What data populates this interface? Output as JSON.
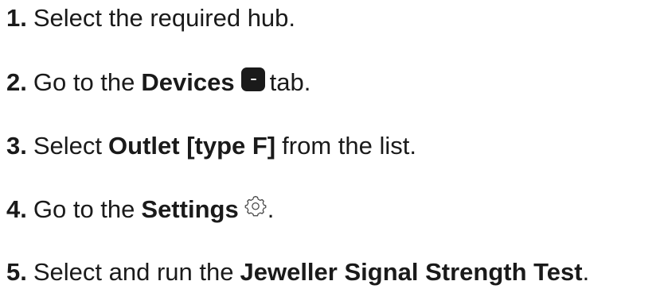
{
  "steps": [
    {
      "number": "1.",
      "parts": [
        "Select the required hub."
      ]
    },
    {
      "number": "2.",
      "parts": [
        "Go to the",
        "Devices",
        "tab."
      ],
      "icon": "devices-tab-icon"
    },
    {
      "number": "3.",
      "parts": [
        "Select",
        "Outlet [type F]",
        "from the list."
      ]
    },
    {
      "number": "4.",
      "parts": [
        "Go to the",
        "Settings",
        "."
      ],
      "icon": "gear-icon"
    },
    {
      "number": "5.",
      "parts": [
        "Select and run the",
        "Jeweller Signal Strength Test",
        "."
      ]
    }
  ]
}
